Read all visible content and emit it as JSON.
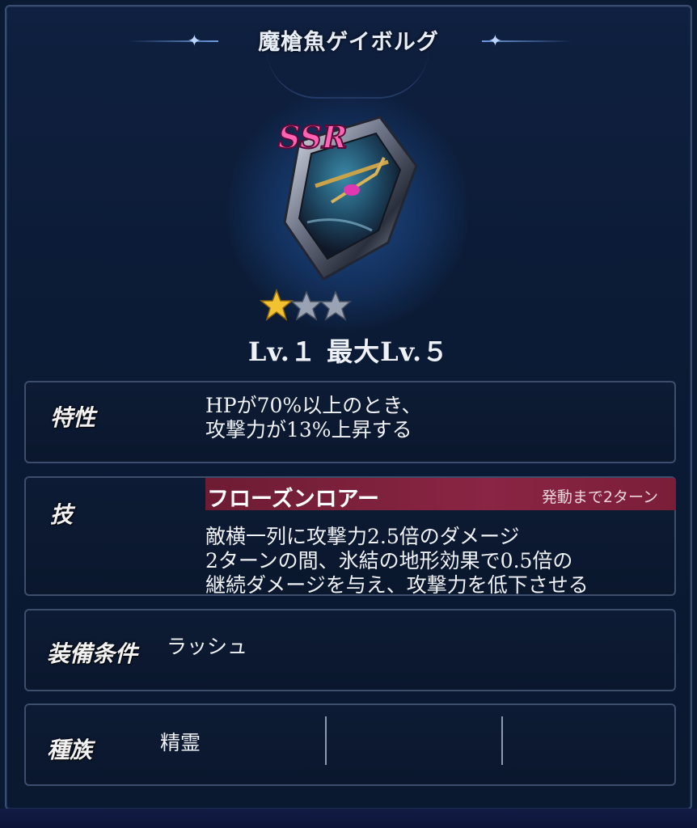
{
  "item": {
    "name": "魔槍魚ゲイボルグ",
    "rarity": "SSR",
    "stars_total": 3,
    "stars_filled": 1,
    "level_text": "Lv.１ 最大Lv.５"
  },
  "trait": {
    "label": "特性",
    "line1": "HPが70%以上のとき、",
    "line2": "攻撃力が13%上昇する"
  },
  "skill": {
    "label": "技",
    "name": "フローズンロアー",
    "cooldown": "発動まで2ターン",
    "line1": "敵横一列に攻撃力2.5倍のダメージ",
    "line2": "2ターンの間、氷結の地形効果で0.5倍の",
    "line3": "継続ダメージを与え、攻撃力を低下させる"
  },
  "equip": {
    "label": "装備条件",
    "value": "ラッシュ"
  },
  "race": {
    "label": "種族",
    "value": "精霊"
  },
  "colors": {
    "skill_bar": "#7a1e38",
    "rarity": "#ff5fb0",
    "background": "#0a1a33",
    "star_gold": "#f2c230",
    "star_empty": "#9aa3b3"
  },
  "icons": [
    "shield-spear-fish-art",
    "star-filled-icon",
    "star-empty-icon",
    "sparkle-icon"
  ]
}
